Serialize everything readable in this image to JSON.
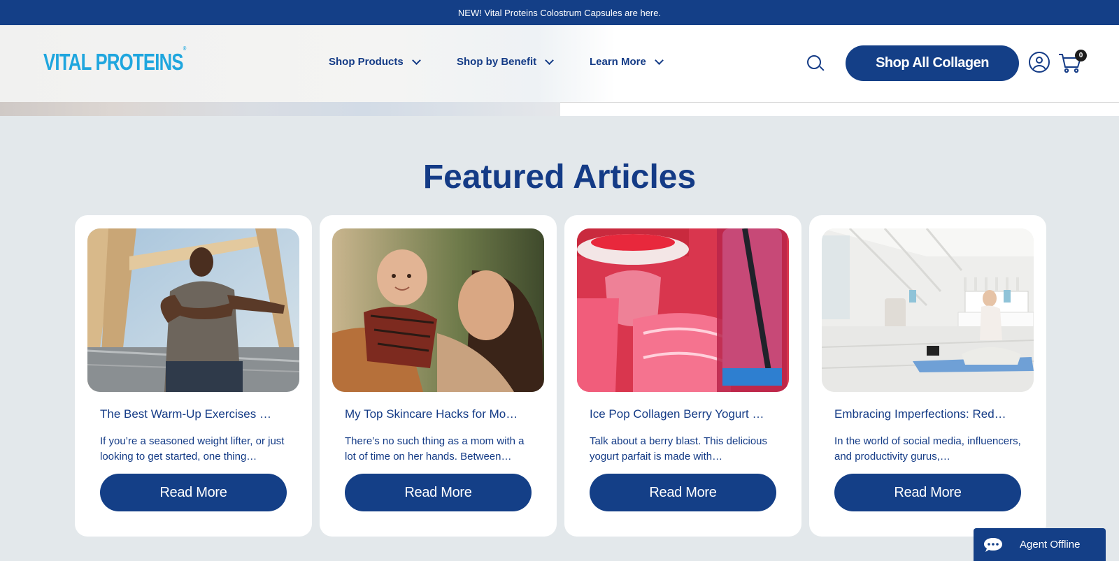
{
  "announcement": {
    "text": "NEW! Vital Proteins Colostrum Capsules are here."
  },
  "header": {
    "logo": "VITAL PROTEINS",
    "logo_mark": "®",
    "nav": [
      {
        "label": "Shop Products"
      },
      {
        "label": "Shop by Benefit"
      },
      {
        "label": "Learn More"
      }
    ],
    "cta": "Shop All Collagen",
    "cart_count": "0"
  },
  "section": {
    "title": "Featured Articles"
  },
  "articles": [
    {
      "title": "The Best Warm-Up Exercises …",
      "excerpt": "If you’re a seasoned weight lifter, or just looking to get started, one thing…",
      "button": "Read More"
    },
    {
      "title": "My Top Skincare Hacks for Mo…",
      "excerpt": "There’s no such thing as a mom with a lot of time on her hands. Between…",
      "button": "Read More"
    },
    {
      "title": "Ice Pop Collagen Berry Yogurt …",
      "excerpt": "Talk about a berry blast. This delicious yogurt parfait is made with…",
      "button": "Read More"
    },
    {
      "title": "Embracing Imperfections: Red…",
      "excerpt": "In the world of social media, influencers, and productivity gurus,…",
      "button": "Read More"
    }
  ],
  "chat": {
    "label": "Agent Offline"
  },
  "colors": {
    "brand_navy": "#143f87",
    "logo_blue": "#1fa6de",
    "background": "#e3e8eb"
  }
}
